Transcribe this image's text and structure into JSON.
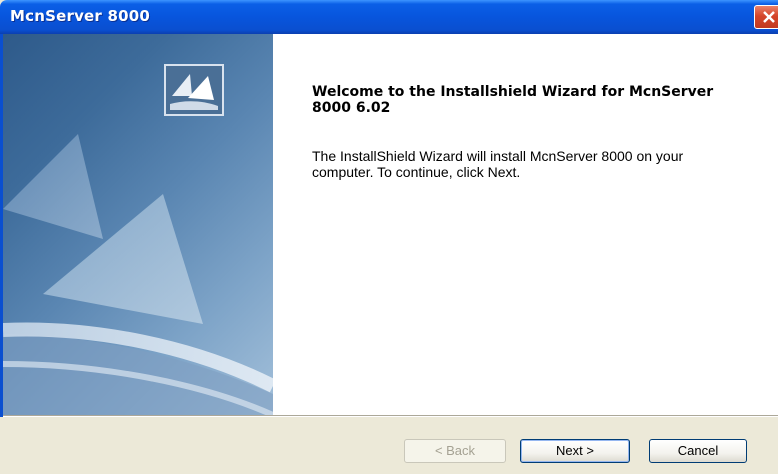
{
  "window": {
    "title": "McnServer 8000"
  },
  "content": {
    "heading": "Welcome to the Installshield Wizard for McnServer 8000 6.02",
    "body": "The InstallShield Wizard will install McnServer 8000 on your computer.  To continue, click Next."
  },
  "buttons": {
    "back": "< Back",
    "next": "Next >",
    "cancel": "Cancel"
  },
  "icons": {
    "close": "close-icon",
    "logo": "installshield-logo-icon"
  },
  "colors": {
    "titlebar": "#0855dd",
    "close_button": "#d5452a",
    "panel_art": "#3d6b9a",
    "dialog_bg": "#ece9d8"
  }
}
